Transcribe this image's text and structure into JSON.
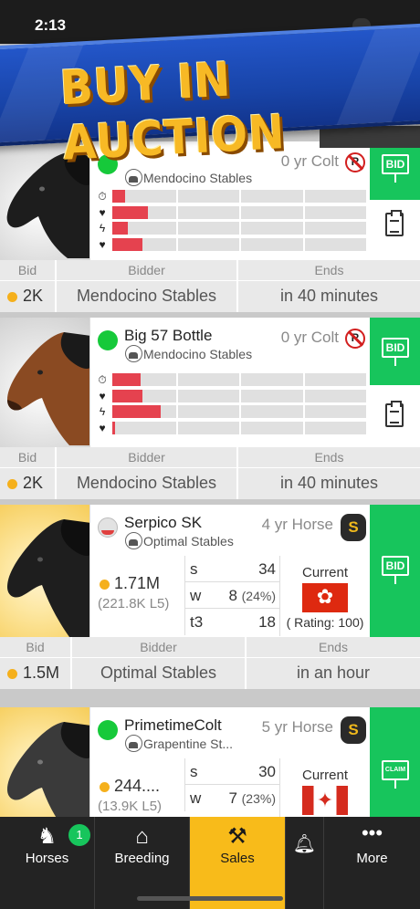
{
  "status_bar": {
    "time": "2:13"
  },
  "banner": {
    "title": "BUY IN AUCTION"
  },
  "bid_header": {
    "bid": "Bid",
    "bidder": "Bidder",
    "ends": "Ends"
  },
  "listings": [
    {
      "name": "",
      "stable": "Mendocino Stables",
      "age": "0 yr Colt",
      "status": "green",
      "restriction_icon": "no-entry-icon",
      "button": "BID",
      "stats_bars": [
        0.05,
        0.14,
        0.06,
        0.12
      ],
      "bid": "2K",
      "bidder": "Mendocino Stables",
      "ends": "in 40 minutes"
    },
    {
      "name": "Big 57 Bottle",
      "stable": "Mendocino Stables",
      "age": "0 yr Colt",
      "status": "green",
      "restriction_icon": "no-entry-icon",
      "button": "BID",
      "stats_bars": [
        0.11,
        0.12,
        0.19,
        0.01
      ],
      "bid": "2K",
      "bidder": "Mendocino Stables",
      "ends": "in 40 minutes"
    },
    {
      "name": "Serpico SK",
      "stable": "Optimal Stables",
      "age": "4 yr Horse",
      "status": "grey",
      "class_badge": "S",
      "button": "BID",
      "earnings": "1.71M",
      "earnings_l5": "(221.8K L5)",
      "starts_label": "s",
      "starts": "34",
      "wins_label": "w",
      "wins": "8",
      "wins_pct": "(24%)",
      "top3_label": "t3",
      "top3": "18",
      "current_label": "Current",
      "flag": "Hong Kong",
      "rating": "( Rating: 100)",
      "bid": "1.5M",
      "bidder": "Optimal Stables",
      "ends": "in an hour"
    },
    {
      "name": "PrimetimeColt",
      "stable": "Grapentine St...",
      "age": "5 yr Horse",
      "status": "green",
      "class_badge": "S",
      "button": "CLAIM",
      "earnings": "244....",
      "earnings_l5": "(13.9K L5)",
      "starts_label": "s",
      "starts": "30",
      "wins_label": "w",
      "wins": "7",
      "wins_pct": "(23%)",
      "current_label": "Current",
      "flag": "Canada"
    }
  ],
  "tabs": [
    {
      "label": "Horses",
      "icon": "horse-head-icon",
      "badge": "1"
    },
    {
      "label": "Breeding",
      "icon": "barn-icon"
    },
    {
      "label": "Sales",
      "icon": "gavel-icon",
      "active": true
    },
    {
      "label": "",
      "icon": "bell-icon"
    },
    {
      "label": "More",
      "icon": "ellipsis-icon"
    }
  ],
  "colors": {
    "bid_green": "#17c55c",
    "bar_red": "#e5424f",
    "accent_gold": "#f8bb1a",
    "banner_blue": "#1844a8"
  }
}
